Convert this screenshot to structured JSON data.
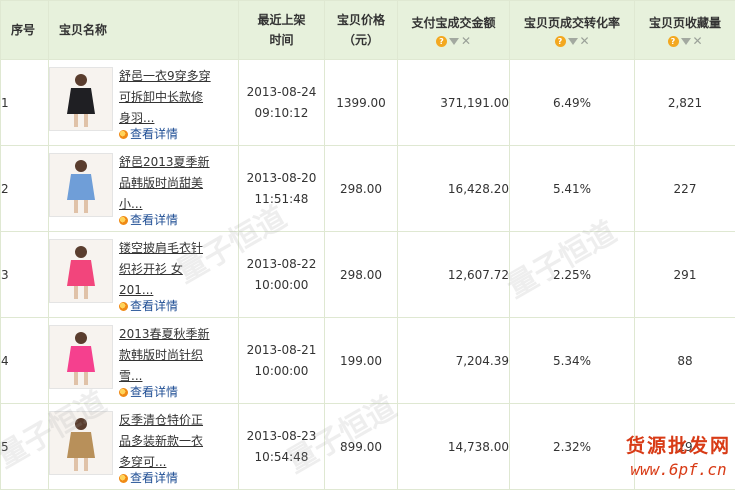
{
  "headers": {
    "index": "序号",
    "name": "宝贝名称",
    "listed_time": "最近上架\n时间",
    "price": "宝贝价格\n（元）",
    "amount": "支付宝成交金额",
    "conversion": "宝贝页成交转化率",
    "favorites": "宝贝页收藏量"
  },
  "sort_icons": [
    "help-icon",
    "sort-down-icon",
    "remove-icon"
  ],
  "detail_label": "查看详情",
  "rows": [
    {
      "no": "1",
      "title": "舒邑一衣9穿多穿可拆卸中长款修身羽...",
      "date": "2013-08-24",
      "time": "09:10:12",
      "price": "1399.00",
      "amount": "371,191.00",
      "conversion": "6.49%",
      "favorites": "2,821",
      "thumb_color": "#1f1f23"
    },
    {
      "no": "2",
      "title": "舒邑2013夏季新品韩版时尚甜美小...",
      "date": "2013-08-20",
      "time": "11:51:48",
      "price": "298.00",
      "amount": "16,428.20",
      "conversion": "5.41%",
      "favorites": "227",
      "thumb_color": "#6f9ed8"
    },
    {
      "no": "3",
      "title": "镂空披肩毛衣针织衫开衫 女201...",
      "date": "2013-08-22",
      "time": "10:00:00",
      "price": "298.00",
      "amount": "12,607.72",
      "conversion": "2.25%",
      "favorites": "291",
      "thumb_color": "#f2457c"
    },
    {
      "no": "4",
      "title": "2013春夏秋季新款韩版时尚针织雪...",
      "date": "2013-08-21",
      "time": "10:00:00",
      "price": "199.00",
      "amount": "7,204.39",
      "conversion": "5.34%",
      "favorites": "88",
      "thumb_color": "#f5408e"
    },
    {
      "no": "5",
      "title": "反季清仓特价正品多装新款一衣多穿可...",
      "date": "2013-08-23",
      "time": "10:54:48",
      "price": "899.00",
      "amount": "14,738.00",
      "conversion": "2.32%",
      "favorites": "29",
      "thumb_color": "#b8905a"
    }
  ],
  "watermark_text": "量子恒道",
  "brand": {
    "name": "货源批发网",
    "url": "www.6pf.cn"
  }
}
